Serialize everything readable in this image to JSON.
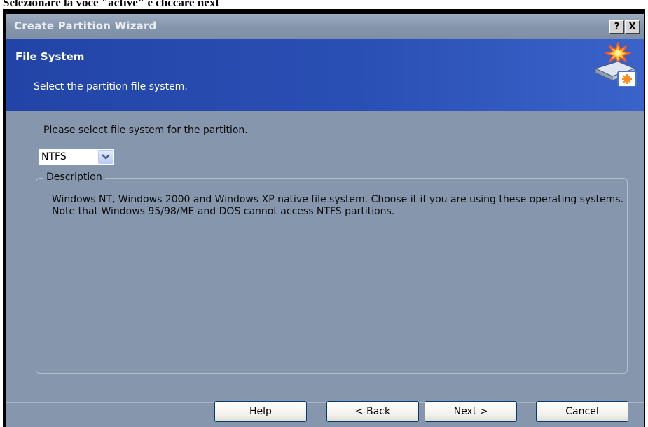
{
  "caption_text": "Selezionare la voce \"active\" e cliccare next",
  "window": {
    "title": "Create Partition Wizard",
    "help_button": "?",
    "close_button": "X"
  },
  "header": {
    "title": "File System",
    "subtitle": "Select the partition file system.",
    "icon": "wizard-disk-icon"
  },
  "body": {
    "prompt": "Please select file system for the partition.",
    "file_system_select": {
      "value": "NTFS"
    },
    "description_group": {
      "legend": "Description",
      "text": "Windows NT, Windows 2000 and Windows XP native file system. Choose it if you are using these operating systems. Note that Windows 95/98/ME and DOS cannot access NTFS partitions."
    }
  },
  "buttons": {
    "help": "Help",
    "back": "< Back",
    "next": "Next >",
    "cancel": "Cancel"
  },
  "colors": {
    "banner": "#2a4fb4",
    "window_body": "#8596ad"
  }
}
